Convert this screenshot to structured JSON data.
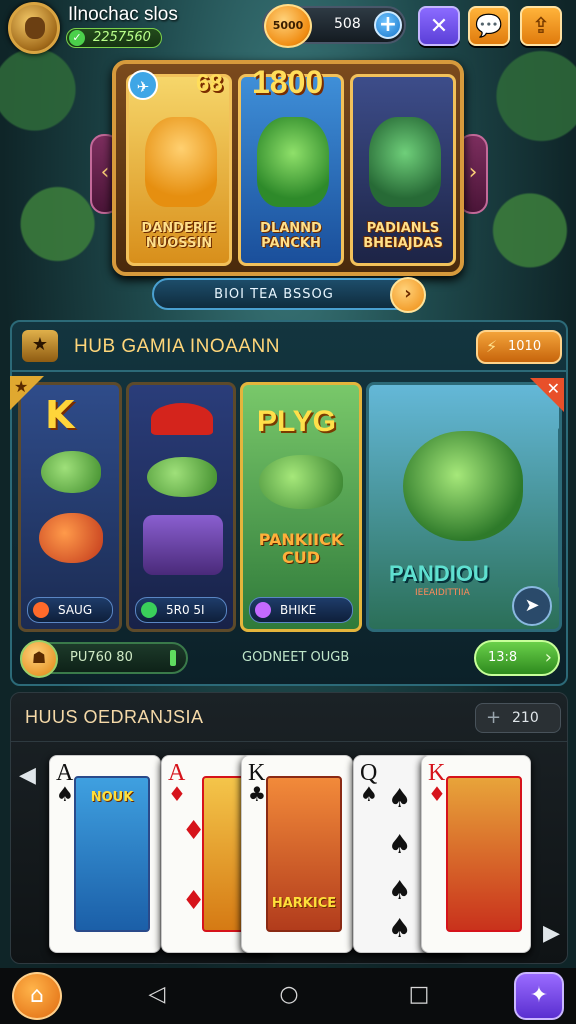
{
  "player": {
    "name": "Ilnochac slos",
    "balance": "2257560"
  },
  "currency": {
    "coin_label": "5000",
    "amount": "508"
  },
  "featured": {
    "badge_left": "68",
    "badge_right": "1800",
    "cards": [
      {
        "title": "DANDERIE NUOSSIN"
      },
      {
        "title": "DLANND PANCKH"
      },
      {
        "title": "PADIANLS BHEIAJDAS"
      }
    ],
    "promo_text": "BIOI TEA BSSOG"
  },
  "hub": {
    "title": "HUB GAMIA INOAANN",
    "pill_value": "1010",
    "cards": [
      {
        "letter": "K",
        "label": "SAUG"
      },
      {
        "label": "5R0 5I"
      },
      {
        "title": "PLYG",
        "subtitle": "PANKIICK CUD",
        "label": "BHIKE"
      },
      {
        "title": "PANDIOU",
        "subtitle": "IEEAIDITTIIA"
      }
    ],
    "wallet_amount": "PU760 80",
    "footer_label": "GODNEET OUGB",
    "play_value": "13:8"
  },
  "cards_section": {
    "title": "HUUS OEDRANJSIA",
    "counter": "210",
    "cards": [
      {
        "rank": "A",
        "suit": "♠",
        "art_caption": "NOUK"
      },
      {
        "rank": "A",
        "suit": "♦"
      },
      {
        "rank": "K",
        "suit": "♣",
        "art_caption": "HARKICE"
      },
      {
        "rank": "Q",
        "suit": "♠"
      },
      {
        "rank": "K",
        "suit": "♦"
      }
    ]
  },
  "colors": {
    "accent_gold": "#f2c15a",
    "accent_green": "#6ad04a",
    "accent_purple": "#8b6bff",
    "panel_teal": "#13353f"
  },
  "icons": [
    "check-icon",
    "coin-icon",
    "plus-icon",
    "close-icon",
    "chat-icon",
    "gift-icon",
    "plane-icon",
    "arrow-right-icon",
    "bolt-icon",
    "share-icon",
    "home-icon",
    "back-icon",
    "circle-home-icon",
    "recent-apps-icon",
    "profile-icon"
  ]
}
